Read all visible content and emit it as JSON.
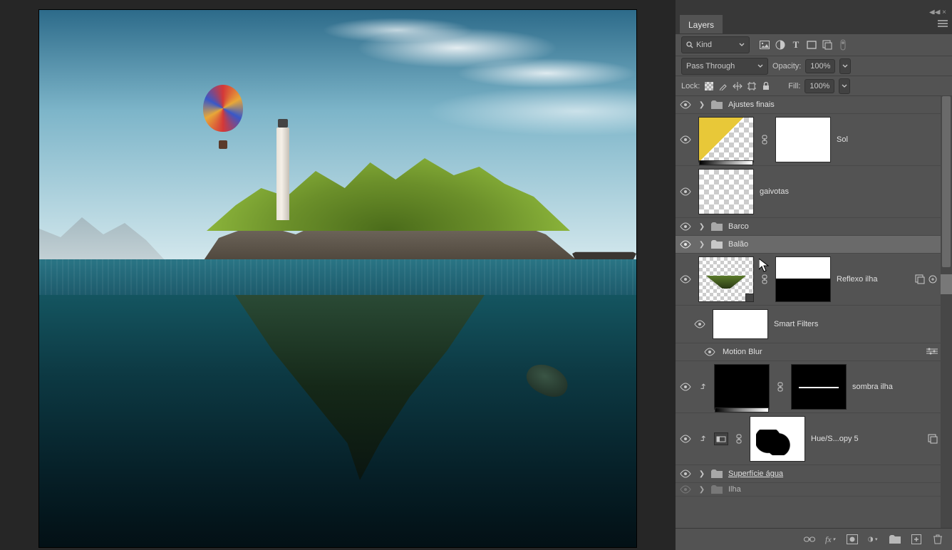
{
  "panel": {
    "tab": "Layers",
    "filter_kind": "Kind",
    "blend_mode": "Pass Through",
    "opacity_label": "Opacity:",
    "opacity_value": "100%",
    "lock_label": "Lock:",
    "fill_label": "Fill:",
    "fill_value": "100%"
  },
  "layers": [
    {
      "type": "group",
      "name": "Ajustes finais"
    },
    {
      "type": "layer",
      "name": "Sol"
    },
    {
      "type": "layer",
      "name": "gaivotas"
    },
    {
      "type": "group",
      "name": "Barco"
    },
    {
      "type": "group",
      "name": "Balão",
      "selected": true
    },
    {
      "type": "layer",
      "name": "Reflexo ilha"
    },
    {
      "type": "smartfilters",
      "name": "Smart Filters"
    },
    {
      "type": "filter",
      "name": "Motion Blur"
    },
    {
      "type": "layer",
      "name": "sombra ilha"
    },
    {
      "type": "adjustment",
      "name": "Hue/S...opy 5"
    },
    {
      "type": "group",
      "name": "Superfície água",
      "underlined": true
    },
    {
      "type": "group",
      "name": "Ilha"
    }
  ]
}
